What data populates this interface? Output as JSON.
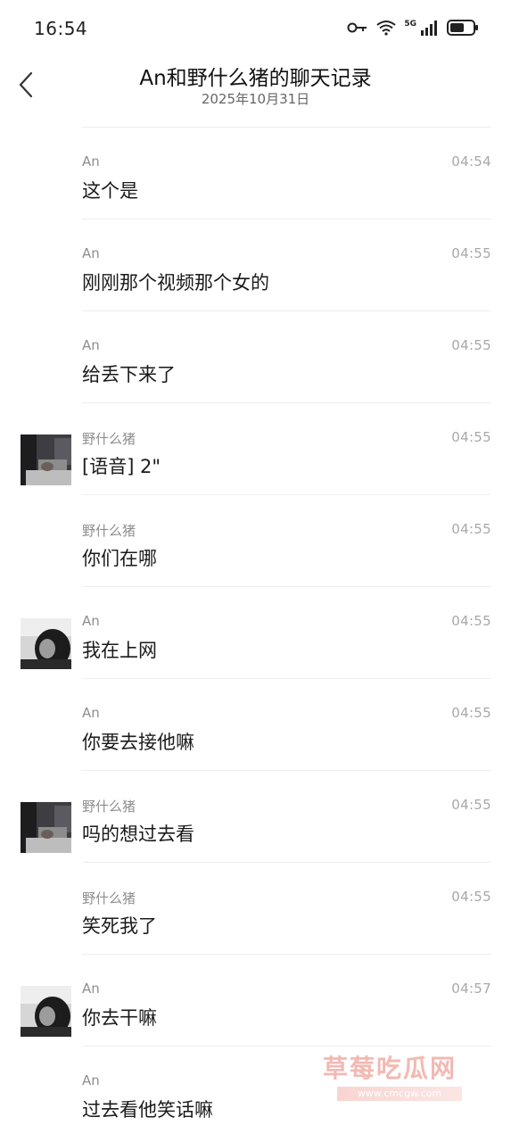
{
  "status_bar": {
    "time": "16:54",
    "network": "5G",
    "icons": [
      "key-icon",
      "wifi-icon",
      "signal-icon",
      "battery-icon"
    ]
  },
  "header": {
    "title": "An和野什么猪的聊天记录",
    "date": "2025年10月31日",
    "back_icon": "chevron-left-icon"
  },
  "messages": [
    {
      "sender": "An",
      "time": "04:54",
      "text": "这个是",
      "avatar": null
    },
    {
      "sender": "An",
      "time": "04:55",
      "text": "刚刚那个视频那个女的",
      "avatar": null
    },
    {
      "sender": "An",
      "time": "04:55",
      "text": "给丢下来了",
      "avatar": null
    },
    {
      "sender": "野什么猪",
      "time": "04:55",
      "text": "[语音] 2\"",
      "avatar": "room"
    },
    {
      "sender": "野什么猪",
      "time": "04:55",
      "text": "你们在哪",
      "avatar": null
    },
    {
      "sender": "An",
      "time": "04:55",
      "text": "我在上网",
      "avatar": "girl"
    },
    {
      "sender": "An",
      "time": "04:55",
      "text": "你要去接他嘛",
      "avatar": null
    },
    {
      "sender": "野什么猪",
      "time": "04:55",
      "text": "吗的想过去看",
      "avatar": "room"
    },
    {
      "sender": "野什么猪",
      "time": "04:55",
      "text": "笑死我了",
      "avatar": null
    },
    {
      "sender": "An",
      "time": "04:57",
      "text": "你去干嘛",
      "avatar": "girl"
    },
    {
      "sender": "An",
      "time": "",
      "text": "过去看他笑话嘛",
      "avatar": null
    }
  ],
  "watermark": {
    "title": "草莓吃瓜网",
    "url": "www.cmcgw.com"
  },
  "colors": {
    "divider": "#ededed",
    "sender_gray": "#8e8e8e",
    "time_gray": "#a8a8a8",
    "watermark_pink": "#f2b9b3"
  }
}
